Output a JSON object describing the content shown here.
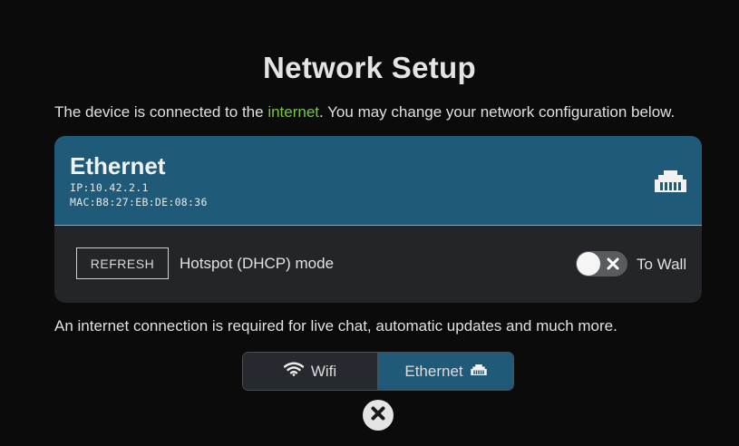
{
  "page": {
    "title": "Network Setup",
    "subtitle_before": "The device is connected to the ",
    "subtitle_link": "internet",
    "subtitle_after": ". You may change your network configuration below.",
    "note": "An internet connection is required for live chat, automatic updates and much more."
  },
  "ethernet_card": {
    "title": "Ethernet",
    "ip": "IP:10.42.2.1",
    "mac": "MAC:B8:27:EB:DE:08:36",
    "icon": "ethernet-port-icon",
    "refresh_label": "REFRESH",
    "mode_label": "Hotspot (DHCP) mode",
    "toggle_label": "To Wall",
    "toggle_on": false
  },
  "tabs": [
    {
      "label": "Wifi",
      "icon": "wifi-icon",
      "selected": false
    },
    {
      "label": "Ethernet",
      "icon": "ethernet-port-icon",
      "selected": true
    }
  ],
  "close_icon": "close-icon",
  "colors": {
    "background": "#0b0b0c",
    "accent_blue": "#1f5b78",
    "link_green": "#7cc245",
    "card_body": "#242528"
  }
}
